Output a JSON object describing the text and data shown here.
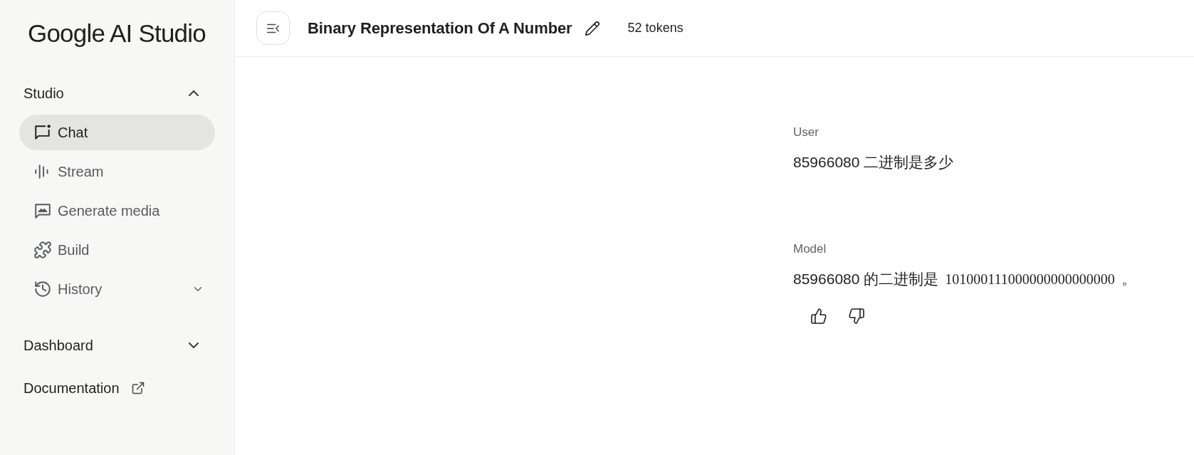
{
  "sidebar": {
    "logo": "Google AI Studio",
    "sections": [
      {
        "kind": "group",
        "label": "Studio",
        "expanded": true,
        "items": [
          {
            "kind": "page",
            "label": "Chat",
            "selected": true
          },
          {
            "kind": "page",
            "label": "Stream",
            "selected": false
          },
          {
            "kind": "page",
            "label": "Generate media",
            "selected": false
          },
          {
            "kind": "page",
            "label": "Build",
            "selected": false
          },
          {
            "kind": "dropdown",
            "label": "History",
            "selected": false,
            "expanded": false
          }
        ]
      },
      {
        "kind": "group",
        "label": "Dashboard",
        "expanded": false
      },
      {
        "kind": "external",
        "label": "Documentation"
      }
    ]
  },
  "header": {
    "title": "Binary Representation Of A Number",
    "tokens": "52 tokens"
  },
  "messages": [
    {
      "kind": "user",
      "role": "User",
      "parts": [
        {
          "kind": "text",
          "text": "85966080 二进制是多少"
        }
      ]
    },
    {
      "kind": "model",
      "role": "Model",
      "parts": [
        {
          "kind": "text",
          "text": "85966080 的二进制是"
        },
        {
          "kind": "math",
          "text": "101000111000000000000000"
        },
        {
          "kind": "text",
          "text": "。"
        }
      ]
    }
  ]
}
